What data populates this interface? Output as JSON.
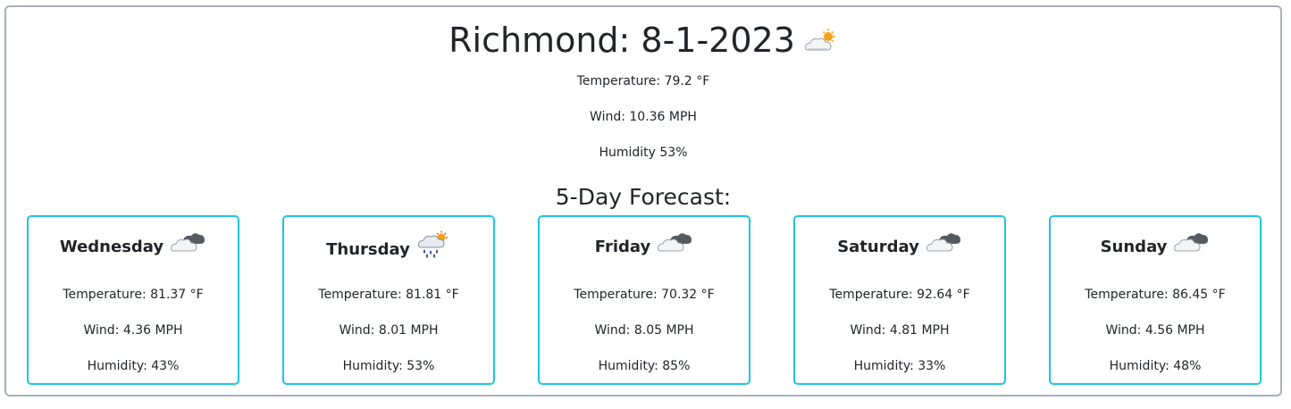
{
  "current": {
    "title": "Richmond: 8-1-2023",
    "icon": "partly-sunny-cloud-icon",
    "temperature": "Temperature: 79.2 °F",
    "wind": "Wind: 10.36 MPH",
    "humidity": "Humidity 53%"
  },
  "forecast_heading": "5-Day Forecast:",
  "days": [
    {
      "name": "Wednesday",
      "icon": "overcast-clouds-icon",
      "temperature": "Temperature: 81.37 °F",
      "wind": "Wind: 4.36 MPH",
      "humidity": "Humidity: 43%"
    },
    {
      "name": "Thursday",
      "icon": "sun-rain-clouds-icon",
      "temperature": "Temperature: 81.81 °F",
      "wind": "Wind: 8.01 MPH",
      "humidity": "Humidity: 53%"
    },
    {
      "name": "Friday",
      "icon": "overcast-clouds-icon",
      "temperature": "Temperature: 70.32 °F",
      "wind": "Wind: 8.05 MPH",
      "humidity": "Humidity: 85%"
    },
    {
      "name": "Saturday",
      "icon": "overcast-clouds-icon",
      "temperature": "Temperature: 92.64 °F",
      "wind": "Wind: 4.81 MPH",
      "humidity": "Humidity: 33%"
    },
    {
      "name": "Sunday",
      "icon": "overcast-clouds-icon",
      "temperature": "Temperature: 86.45 °F",
      "wind": "Wind: 4.56 MPH",
      "humidity": "Humidity: 48%"
    }
  ],
  "colors": {
    "card_border": "#1ec3ea",
    "panel_border": "#aab0b6",
    "text": "#212529"
  }
}
